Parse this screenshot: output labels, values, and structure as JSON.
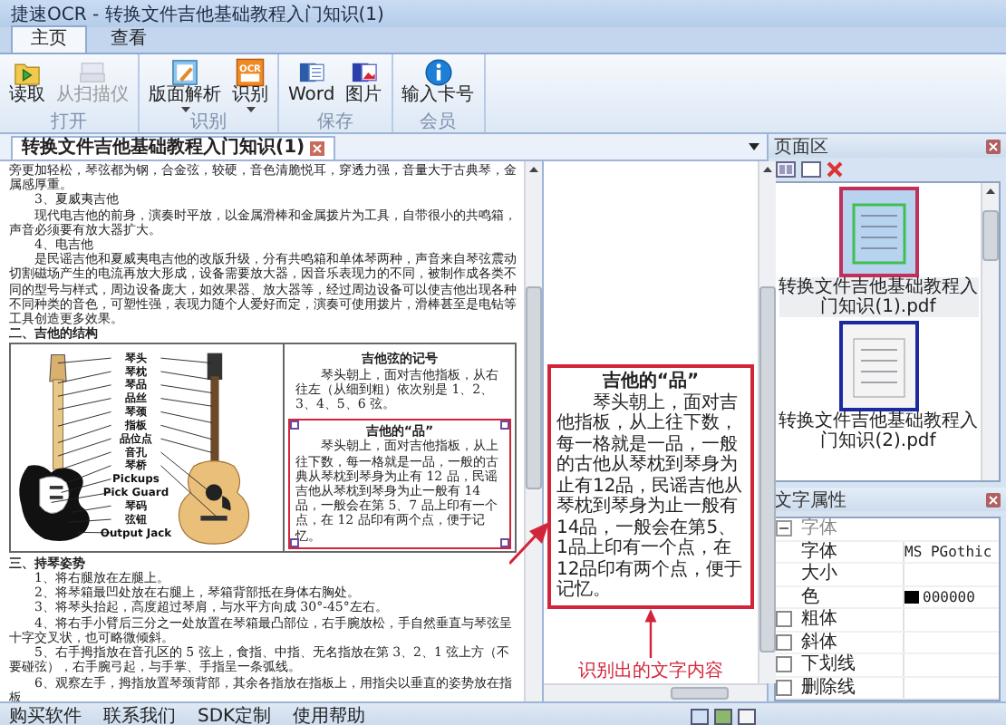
{
  "window": {
    "title": "捷速OCR - 转换文件吉他基础教程入门知识(1)"
  },
  "tabs": [
    {
      "label": "主页",
      "selected": true
    },
    {
      "label": "查看",
      "selected": false
    }
  ],
  "ribbon": [
    {
      "label": "打开",
      "buttons": [
        {
          "kind": "folder",
          "label": "读取",
          "disabled": false,
          "dropdown": false
        },
        {
          "kind": "scanner",
          "label": "从扫描仪",
          "disabled": true,
          "dropdown": false
        }
      ]
    },
    {
      "label": "识别",
      "buttons": [
        {
          "kind": "layout",
          "label": "版面解析",
          "disabled": false,
          "dropdown": true
        },
        {
          "kind": "ocr",
          "label": "识别",
          "badge": "OCR",
          "disabled": false,
          "dropdown": true
        }
      ]
    },
    {
      "label": "保存",
      "buttons": [
        {
          "kind": "word",
          "label": "Word",
          "disabled": false,
          "dropdown": false
        },
        {
          "kind": "image",
          "label": "图片",
          "disabled": false,
          "dropdown": false
        }
      ]
    },
    {
      "label": "会员",
      "buttons": [
        {
          "kind": "info",
          "label": "输入卡号",
          "disabled": false,
          "dropdown": false
        }
      ]
    }
  ],
  "document_tab": {
    "title": "转换文件吉他基础教程入门知识(1)"
  },
  "document": [
    {
      "kind": "text",
      "text": "旁更加轻松，琴弦都为钢，合金弦，较硬，音色清脆悦耳，穿透力强，音量大于古典琴，金属感厚重。"
    },
    {
      "kind": "paragraph",
      "text": "3、夏威夷吉他"
    },
    {
      "kind": "paragraph",
      "text": "现代电吉他的前身，演奏时平放，以金属滑棒和金属拨片为工具，自带很小的共鸣箱，声音必须要有放大器扩大。"
    },
    {
      "kind": "paragraph",
      "text": "4、电吉他"
    },
    {
      "kind": "paragraph",
      "text": "是民谣吉他和夏威夷电吉他的改版升级，分有共鸣箱和单体琴两种，声音来自琴弦震动切割磁场产生的电流再放大形成，设备需要放大器，因音乐表现力的不同，被制作成各类不同的型号与样式，周边设备庞大，如效果器、放大器等，经过周边设备可以使吉他出现各种不同种类的音色，可塑性强，表现力随个人爱好而定，演奏可使用拨片，滑棒甚至是电钻等工具创造更多效果。"
    },
    {
      "kind": "heading",
      "text": "二、吉他的结构"
    },
    {
      "kind": "figure",
      "labels": [
        "琴头",
        "琴枕",
        "琴品",
        "品丝",
        "琴颈",
        "指板",
        "品位点",
        "音孔",
        "琴桥",
        "Pickups",
        "Pick Guard",
        "琴码",
        "弦钮",
        "Output Jack"
      ],
      "notes": [
        {
          "title": "吉他弦的记号",
          "body": "琴头朝上，面对吉他指板，从右往左（从细到粗）依次别是 1、2、3、4、5、6 弦。",
          "selected": false
        },
        {
          "title": "吉他的“品”",
          "body": "琴头朝上，面对吉他指板，从上往下数，每一格就是一品，一般的古典从琴枕到琴身为止有 12 品，民谣吉他从琴枕到琴身为止一般有 14 品，一般会在第 5、7 品上印有一个点，在 12 品印有两个点，便于记忆。",
          "selected": true
        }
      ]
    },
    {
      "kind": "heading",
      "text": "三、持琴姿势"
    },
    {
      "kind": "paragraph",
      "text": "1、将右腿放在左腿上。"
    },
    {
      "kind": "paragraph",
      "text": "2、将琴箱最凹处放在右腿上，琴箱背部抵在身体右胸处。"
    },
    {
      "kind": "paragraph",
      "text": "3、将琴头抬起，高度超过琴肩，与水平方向成 30°-45°左右。"
    },
    {
      "kind": "paragraph",
      "text": "4、将右手小臂后三分之一处放置在琴箱最凸部位，右手腕放松，手自然垂直与琴弦呈十字交叉状，也可略微倾斜。"
    },
    {
      "kind": "paragraph",
      "text": "5、右手拇指放在音孔区的 5 弦上，食指、中指、无名指放在第 3、2、1 弦上方（不要碰弦），右手腕弓起，与手掌、手指呈一条弧线。"
    },
    {
      "kind": "paragraph",
      "text": "6、观察左手，拇指放置琴颈背部，其余各指放在指板上，用指尖以垂直的姿势放在指板"
    }
  ],
  "ocr_result": {
    "title": "吉他的“品”",
    "body": "琴头朝上，面对吉他指板，从上往下数，每一格就是一品，一般的古他从琴枕到琴身为止有12品，民谣吉他从琴枕到琴身为止一般有14品，一般会在第5、1品上印有一个点，在12品印有两个点，便于记忆。"
  },
  "annotation": "识别出的文字内容",
  "pages_panel": {
    "title": "页面区",
    "pages": [
      {
        "name": "转换文件吉他基础教程入门知识(1).pdf",
        "selected": true
      },
      {
        "name": "转换文件吉他基础教程入门知识(2).pdf",
        "selected": false
      }
    ]
  },
  "text_properties": {
    "title": "文字属性",
    "group": {
      "label": "字体",
      "expanded": true
    },
    "rows": [
      {
        "kind": "value",
        "label": "字体",
        "value": "MS PGothic"
      },
      {
        "kind": "value",
        "label": "大小"
      },
      {
        "kind": "color",
        "label": "色",
        "value": "000000"
      },
      {
        "kind": "checkbox",
        "label": "粗体",
        "checked": false
      },
      {
        "kind": "checkbox",
        "label": "斜体",
        "checked": false
      },
      {
        "kind": "checkbox",
        "label": "下划线",
        "checked": false
      },
      {
        "kind": "checkbox",
        "label": "删除线",
        "checked": false
      }
    ]
  },
  "status_bar": [
    "购买软件",
    "联系我们",
    "SDK定制",
    "使用帮助"
  ]
}
